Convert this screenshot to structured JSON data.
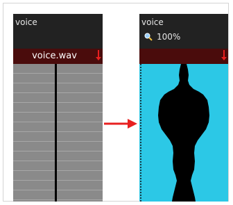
{
  "left_column": {
    "title": "voice",
    "sound_file": "voice.wav"
  },
  "right_column": {
    "title": "voice",
    "zoom": "100%"
  },
  "colors": {
    "header_bg": "#222222",
    "wav_bar_bg": "#4a0c0c",
    "marker": "#e82020",
    "cell_bg": "#8a8a8a",
    "wave_bg": "#2cc8e6",
    "arrow": "#e82020"
  },
  "icons": {
    "zoom": "magnifier-icon",
    "arrow": "right-arrow-icon",
    "marker": "down-arrow-marker-icon"
  }
}
